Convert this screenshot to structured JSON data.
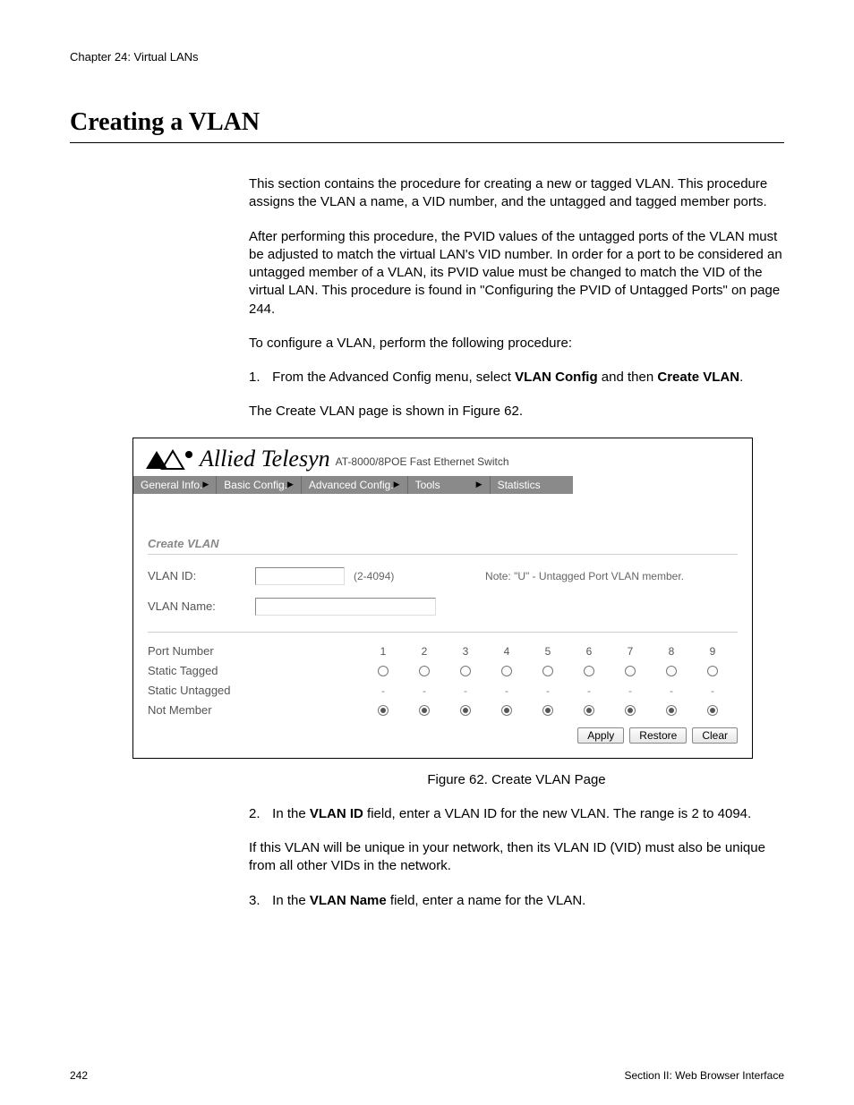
{
  "header": {
    "chapter": "Chapter 24: Virtual LANs"
  },
  "title": "Creating a VLAN",
  "paragraphs": {
    "p1": "This section contains the procedure for creating a new or tagged VLAN. This procedure assigns the VLAN a name, a VID number, and the untagged and tagged member ports.",
    "p2": "After performing this procedure, the PVID values of the untagged ports of the VLAN must be adjusted to match the virtual LAN's VID number. In order for a port to be considered an untagged member of a VLAN, its PVID value must be changed to match the VID of the virtual LAN. This procedure is found in \"Configuring the PVID of Untagged Ports\" on page 244.",
    "p3": "To configure a VLAN, perform the following procedure:"
  },
  "steps": {
    "s1_pre": "From the Advanced Config menu, select ",
    "s1_b1": "VLAN Config",
    "s1_mid": " and then ",
    "s1_b2": "Create VLAN",
    "s1_post": ".",
    "s1_follow": "The Create VLAN page is shown in Figure 62.",
    "s2_pre": "In the ",
    "s2_b1": "VLAN ID",
    "s2_post": " field, enter a VLAN ID for the new VLAN. The range is 2 to 4094.",
    "s2_follow": "If this VLAN will be unique in your network, then its VLAN ID (VID) must also be unique from all other VIDs in the network.",
    "s3_pre": "In the ",
    "s3_b1": "VLAN Name",
    "s3_post": " field, enter a name for the VLAN."
  },
  "screenshot": {
    "brand": "Allied Telesyn",
    "subtitle": "AT-8000/8POE Fast Ethernet Switch",
    "menu": [
      "General Info.",
      "Basic Config.",
      "Advanced Config.",
      "Tools",
      "Statistics"
    ],
    "panel_title": "Create VLAN",
    "labels": {
      "vlan_id": "VLAN ID:",
      "vlan_name": "VLAN Name:",
      "range": "(2-4094)",
      "note": "Note: \"U\" - Untagged Port VLAN member."
    },
    "port_rows": {
      "header": "Port Number",
      "tagged": "Static Tagged",
      "untagged": "Static Untagged",
      "notmember": "Not Member"
    },
    "buttons": {
      "apply": "Apply",
      "restore": "Restore",
      "clear": "Clear"
    }
  },
  "chart_data": {
    "type": "table",
    "title": "Create VLAN port membership defaults",
    "columns": [
      "Port Number",
      "1",
      "2",
      "3",
      "4",
      "5",
      "6",
      "7",
      "8",
      "9"
    ],
    "rows": [
      {
        "label": "Static Tagged",
        "cells": [
          "o",
          "o",
          "o",
          "o",
          "o",
          "o",
          "o",
          "o",
          "o"
        ]
      },
      {
        "label": "Static Untagged",
        "cells": [
          "-",
          "-",
          "-",
          "-",
          "-",
          "-",
          "-",
          "-",
          "-"
        ]
      },
      {
        "label": "Not Member",
        "cells": [
          "•",
          "•",
          "•",
          "•",
          "•",
          "•",
          "•",
          "•",
          "•"
        ]
      }
    ],
    "legend": {
      "o": "unselected radio",
      "•": "selected radio",
      "-": "not available"
    }
  },
  "figure_caption": "Figure 62. Create VLAN Page",
  "footer": {
    "page": "242",
    "section": "Section II: Web Browser Interface"
  }
}
